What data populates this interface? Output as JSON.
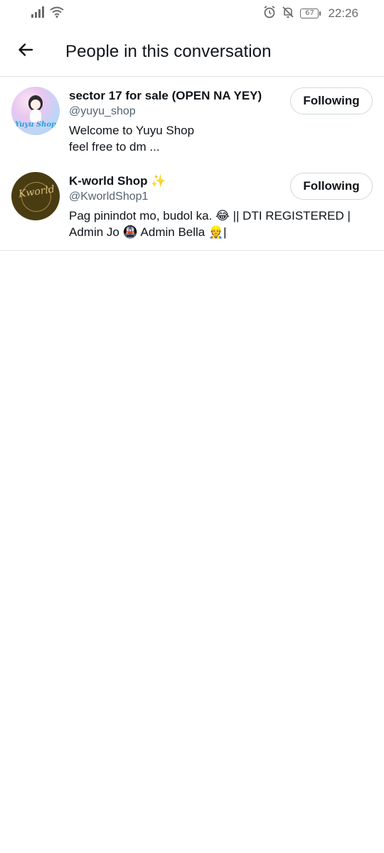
{
  "status_bar": {
    "time": "22:26",
    "battery_level": "67",
    "icons": [
      "signal-icon",
      "wifi-icon",
      "alarm-icon",
      "notifications-off-icon",
      "battery-icon"
    ]
  },
  "header": {
    "title": "People in this conversation",
    "back_icon": "arrow-left-icon"
  },
  "people": [
    {
      "name": "sector 17 for sale (OPEN NA YEY)",
      "handle": "@yuyu_shop",
      "bio": "Welcome to Yuyu Shop\nfeel free to dm ...",
      "avatar_text": "Yuyu Shop",
      "button_label": "Following"
    },
    {
      "name": "K-world Shop ✨",
      "handle": "@KworldShop1",
      "bio": "Pag pinindot mo, budol ka. 😂 || DTI REGISTERED | Admin Jo 🚇 Admin Bella 👷|",
      "avatar_text": "Kworld",
      "button_label": "Following"
    }
  ]
}
